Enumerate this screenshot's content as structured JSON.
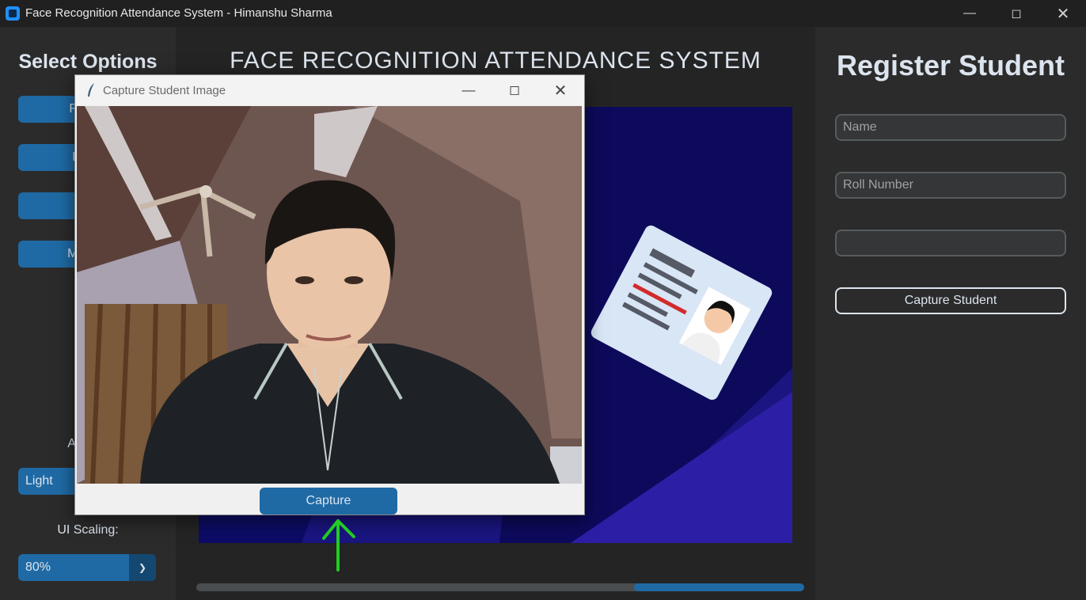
{
  "window": {
    "title": "Face Recognition Attendance System - Himanshu Sharma",
    "minimize_icon": "minimize-icon",
    "maximize_icon": "maximize-icon",
    "close_icon": "close-icon"
  },
  "sidebar": {
    "title": "Select Options",
    "buttons": [
      {
        "label": "Regist"
      },
      {
        "label": "Delet"
      },
      {
        "label": "Trai"
      },
      {
        "label": "Mark A"
      }
    ],
    "appearance_label": "Appear",
    "appearance_value": "Light",
    "scaling_label": "UI Scaling:",
    "scaling_value": "80%"
  },
  "main": {
    "title": "FACE RECOGNITION ATTENDANCE SYSTEM",
    "progress_fraction": 0.28
  },
  "register": {
    "title": "Register Student",
    "name_placeholder": "Name",
    "roll_placeholder": "Roll Number",
    "third_placeholder": "",
    "capture_label": "Capture Student"
  },
  "dialog": {
    "title": "Capture Student Image",
    "capture_label": "Capture"
  },
  "colors": {
    "accent": "#1f6aa5",
    "background": "#242424",
    "panel": "#2b2b2b",
    "annotation_arrow": "#22cc22"
  }
}
